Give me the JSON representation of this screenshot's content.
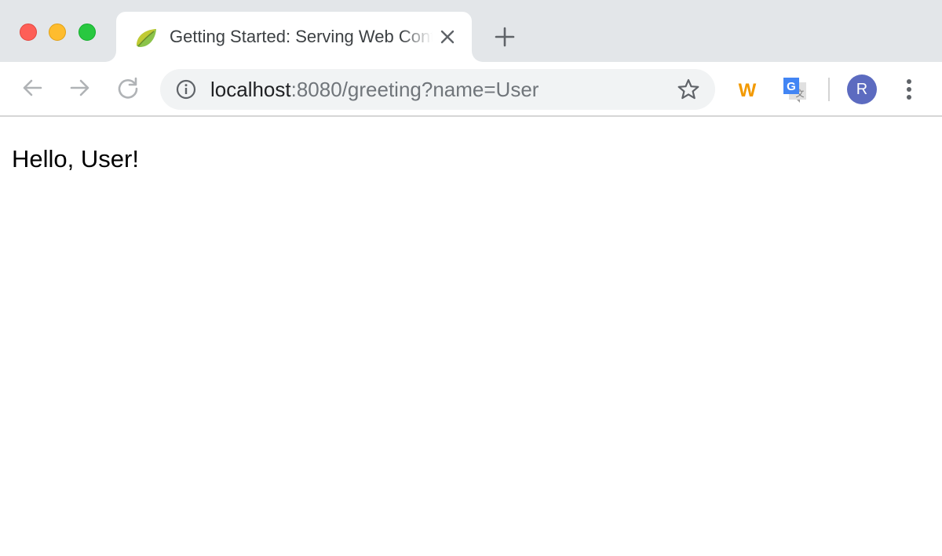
{
  "window": {
    "controls": [
      "close",
      "minimize",
      "zoom"
    ]
  },
  "tab": {
    "title": "Getting Started: Serving Web Content",
    "favicon": "spring-leaf-icon",
    "close_icon": "close-icon"
  },
  "toolbar": {
    "back_icon": "back-arrow-icon",
    "forward_icon": "forward-arrow-icon",
    "reload_icon": "reload-icon",
    "address": {
      "host": "localhost",
      "rest": ":8080/greeting?name=User",
      "info_icon": "info-icon",
      "bookmark_icon": "star-icon"
    },
    "extensions": [
      {
        "name": "w-extension-icon",
        "label": "W",
        "color": "#f29900"
      },
      {
        "name": "google-translate-icon",
        "label": "G",
        "color": "#4285f4"
      }
    ],
    "profile": {
      "initial": "R",
      "color": "#5c6bc0"
    },
    "menu_icon": "more-vert-icon"
  },
  "page": {
    "greeting": "Hello, User!"
  }
}
